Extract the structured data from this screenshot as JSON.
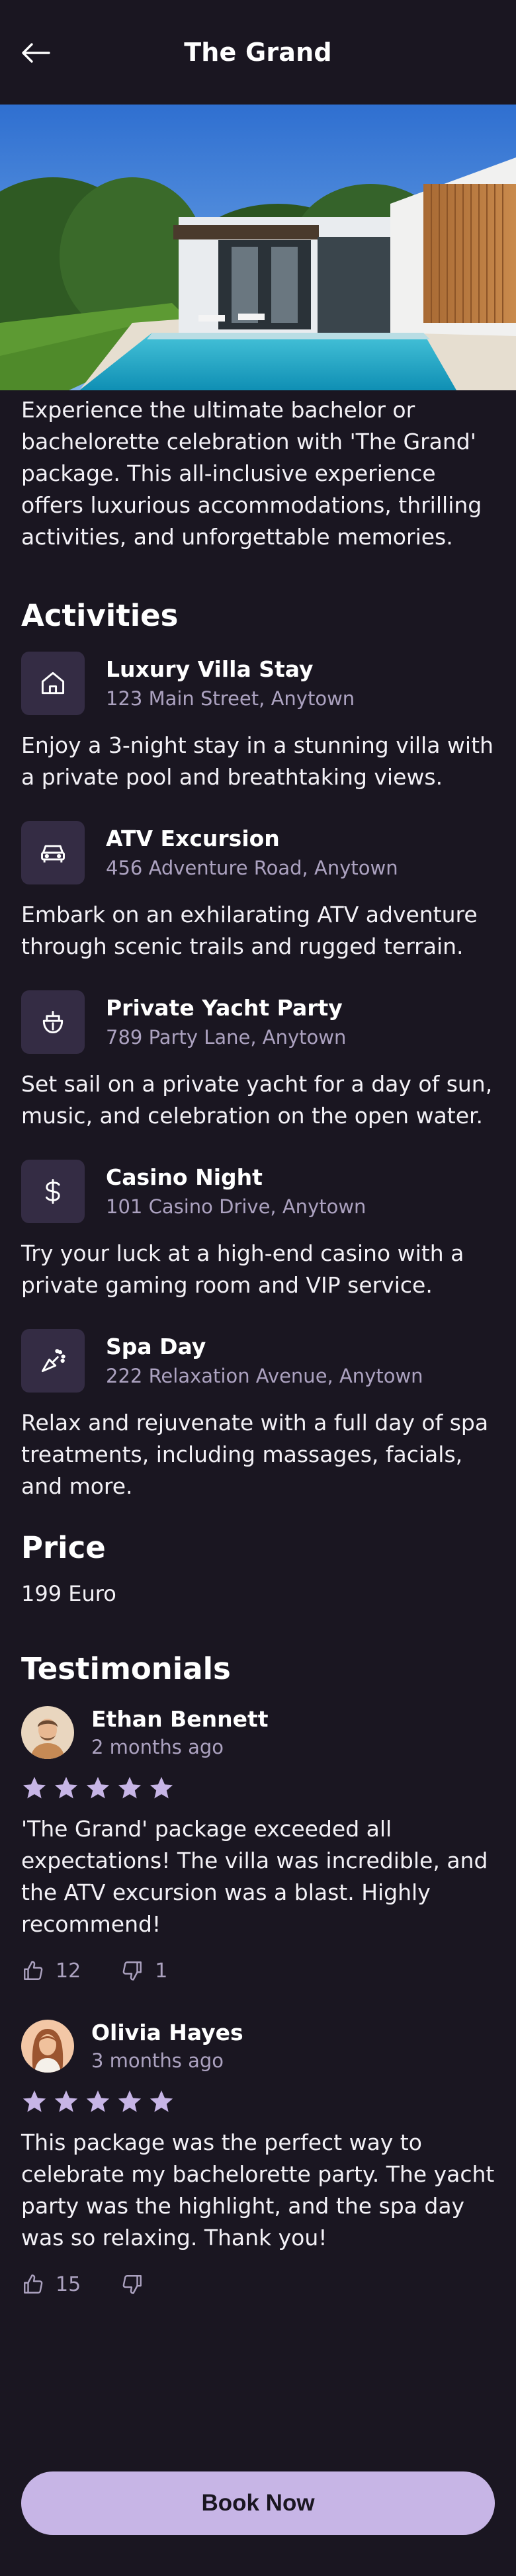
{
  "header": {
    "title": "The Grand",
    "back_icon": "arrow-left-icon"
  },
  "hero": {
    "image": "villa-pool-photo"
  },
  "description": "Experience the ultimate bachelor or bachelorette celebration with 'The Grand' package. This all-inclusive experience offers luxurious accommodations, thrilling activities, and unforgettable memories.",
  "activities": {
    "title": "Activities",
    "items": [
      {
        "icon": "home-icon",
        "name": "Luxury Villa Stay",
        "address": "123 Main Street, Anytown",
        "description": "Enjoy a 3-night stay in a stunning villa with a private pool and breathtaking views."
      },
      {
        "icon": "car-icon",
        "name": "ATV Excursion",
        "address": "456 Adventure Road, Anytown",
        "description": "Embark on an exhilarating ATV adventure through scenic trails and rugged terrain."
      },
      {
        "icon": "yacht-icon",
        "name": "Private Yacht Party",
        "address": "789 Party Lane, Anytown",
        "description": "Set sail on a private yacht for a day of sun, music, and celebration on the open water."
      },
      {
        "icon": "dollar-icon",
        "name": "Casino Night",
        "address": "101 Casino Drive, Anytown",
        "description": "Try your luck at a high-end casino with a private gaming room and VIP service."
      },
      {
        "icon": "spa-icon",
        "name": "Spa Day",
        "address": "222 Relaxation Avenue, Anytown",
        "description": "Relax and rejuvenate with a full day of spa treatments, including massages, facials, and more."
      }
    ]
  },
  "price": {
    "title": "Price",
    "value": "199 Euro"
  },
  "testimonials": {
    "title": "Testimonials",
    "items": [
      {
        "name": "Ethan Bennett",
        "date": "2 months ago",
        "rating": 5,
        "text": "'The Grand' package exceeded all expectations! The villa was incredible, and the ATV excursion was a blast. Highly recommend!",
        "likes": "12",
        "dislikes": "1"
      },
      {
        "name": "Olivia Hayes",
        "date": "3 months ago",
        "rating": 5,
        "text": "This package was the perfect way to celebrate my bachelorette party. The yacht party was the highlight, and the spa day was so relaxing. Thank you!",
        "likes": "15",
        "dislikes": ""
      }
    ]
  },
  "cta": {
    "label": "Book Now"
  },
  "colors": {
    "background": "#1a1621",
    "accent": "#c7b5e6",
    "icon_tile": "#342c44",
    "muted_text": "#aca2c0",
    "star": "#c7b5e6"
  }
}
